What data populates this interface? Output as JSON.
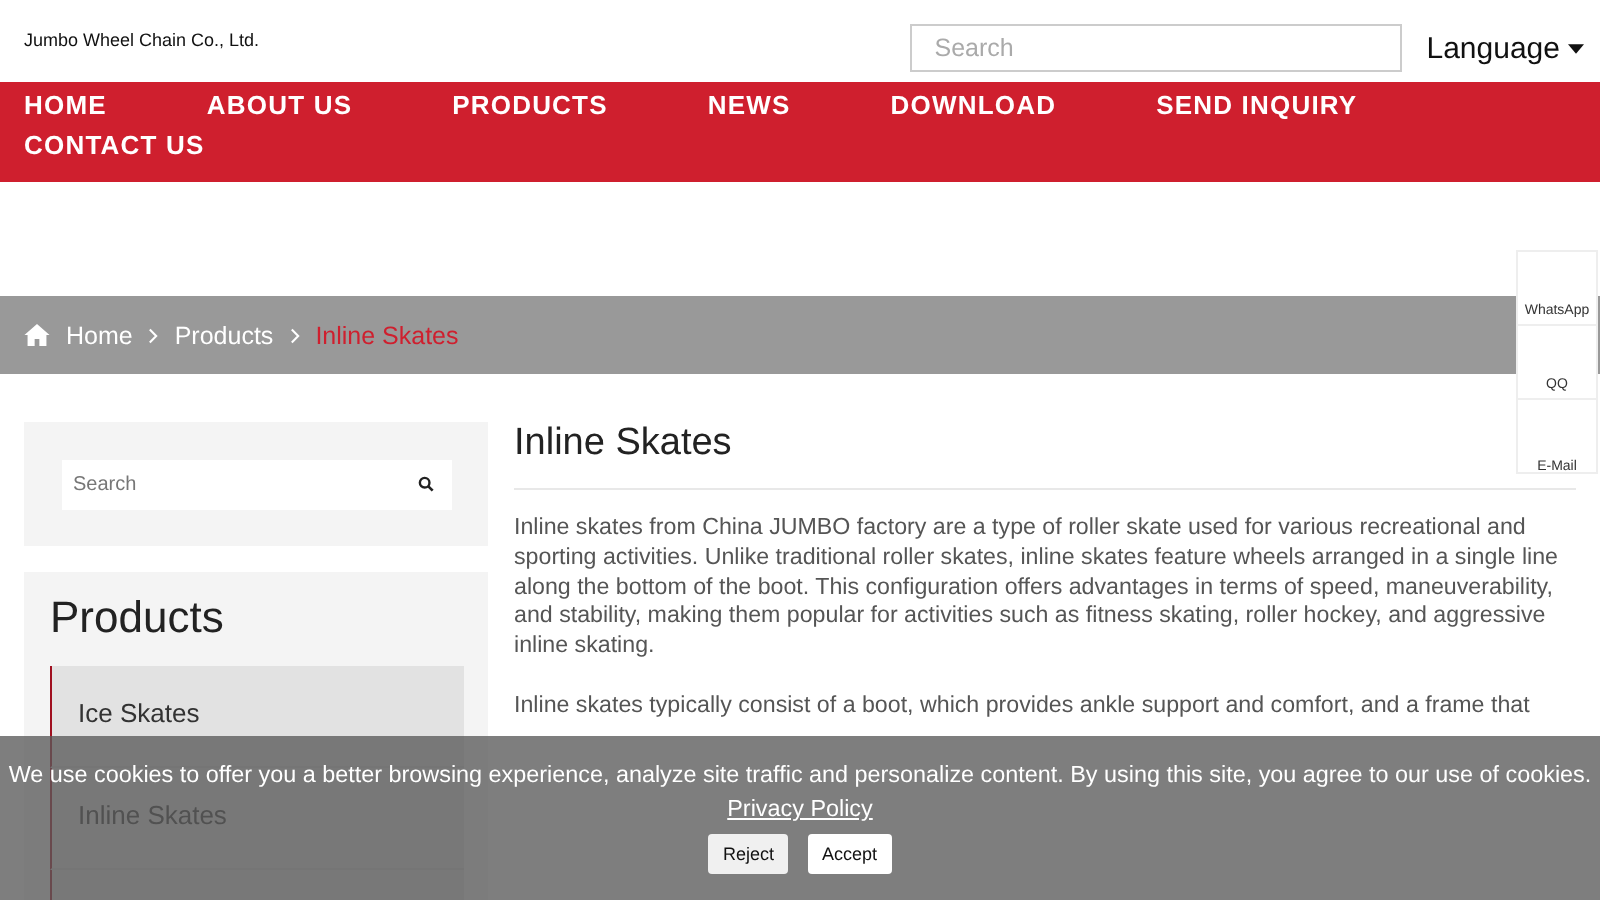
{
  "header": {
    "company": "Jumbo Wheel Chain Co., Ltd.",
    "search": {
      "placeholder": "Search"
    },
    "language": "Language"
  },
  "nav": [
    {
      "label": "HOME"
    },
    {
      "label": "ABOUT US"
    },
    {
      "label": "PRODUCTS"
    },
    {
      "label": "NEWS"
    },
    {
      "label": "DOWNLOAD"
    },
    {
      "label": "SEND INQUIRY"
    },
    {
      "label": "CONTACT US"
    }
  ],
  "breadcrumb": [
    {
      "label": "Home",
      "current": false
    },
    {
      "label": "Products",
      "current": false
    },
    {
      "label": "Inline Skates",
      "current": true
    }
  ],
  "sidebar": {
    "search": {
      "placeholder": "Search"
    },
    "title": "Products",
    "items": [
      {
        "label": "Ice Skates"
      },
      {
        "label": "Inline Skates"
      }
    ]
  },
  "article": {
    "title": "Inline Skates",
    "paragraphs": [
      "Inline skates from China JUMBO factory are a type of roller skate used for various recreational and sporting activities. Unlike traditional roller skates, inline skates feature wheels arranged in a single line along the bottom of the boot. This configuration offers advantages in terms of speed, maneuverability, and stability, making them popular for activities such as fitness skating, roller hockey, and aggressive inline skating.",
      "Inline skates typically consist of a boot, which provides ankle support and comfort, and a frame that"
    ]
  },
  "contact_panel": [
    {
      "label": "WhatsApp"
    },
    {
      "label": "QQ"
    },
    {
      "label": "E-Mail"
    }
  ],
  "cookie_banner": {
    "message": "We use cookies to offer you a better browsing experience, analyze site traffic and personalize content. By using this site, you agree to our use of cookies.",
    "link": "Privacy Policy",
    "buttons": [
      "Reject",
      "Accept"
    ]
  }
}
